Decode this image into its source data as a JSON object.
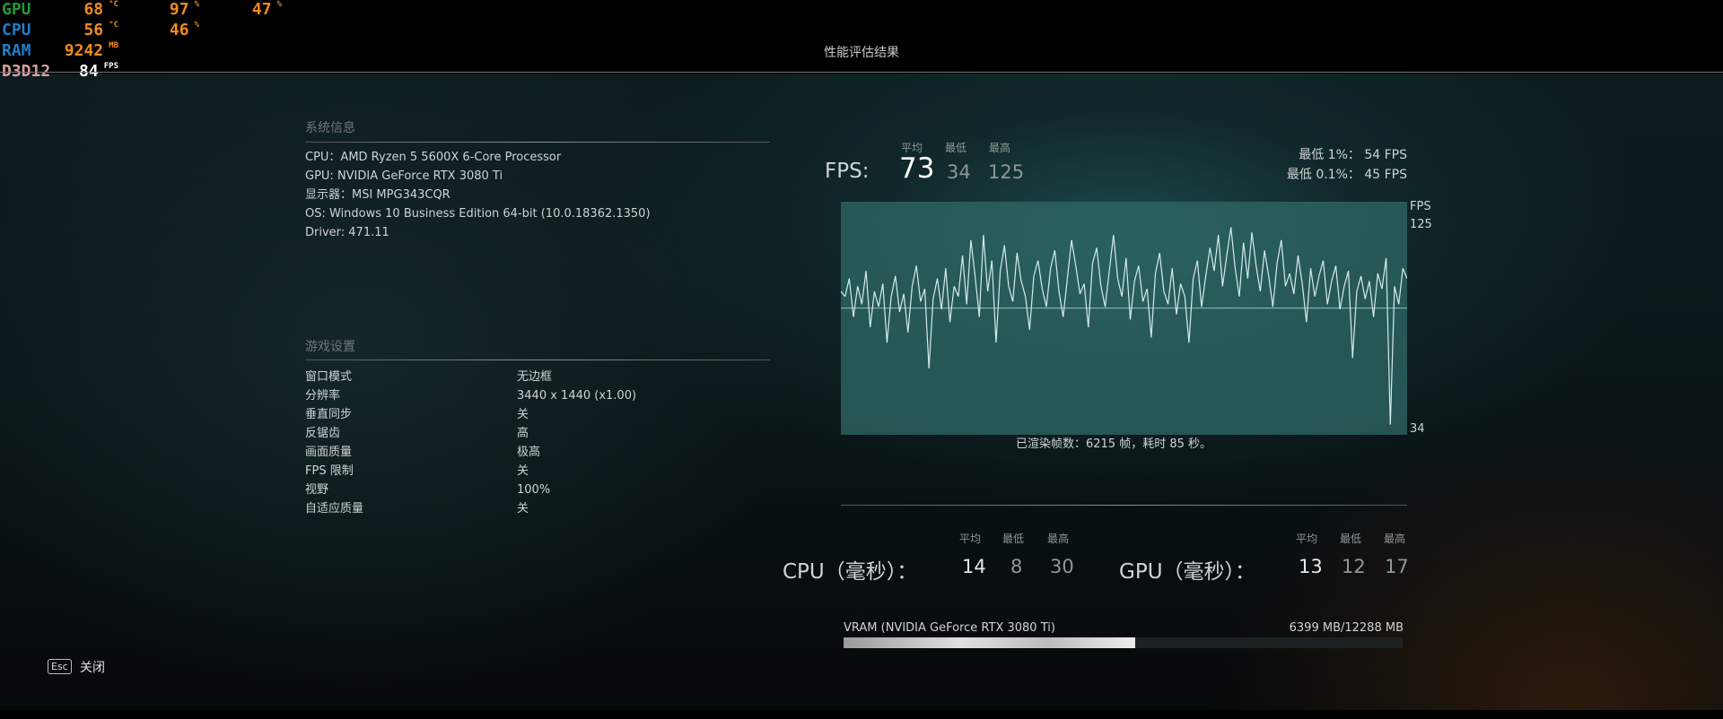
{
  "hud": [
    {
      "label": "GPU",
      "label_color": "#1e9a3a",
      "values": [
        {
          "v": "68",
          "u": "°C"
        },
        {
          "v": "97",
          "u": "%"
        },
        {
          "v": "47",
          "u": "%"
        }
      ]
    },
    {
      "label": "CPU",
      "label_color": "#1e7fc8",
      "values": [
        {
          "v": "56",
          "u": "°C"
        },
        {
          "v": "46",
          "u": "%"
        }
      ]
    },
    {
      "label": "RAM",
      "label_color": "#1e7fc8",
      "values": [
        {
          "v": "9242",
          "u": "MB"
        }
      ]
    },
    {
      "label": "D3D12",
      "label_color": "#d8a0a0",
      "values": [
        {
          "v": "84",
          "u": "FPS"
        }
      ]
    }
  ],
  "title": "性能评估结果",
  "system": {
    "heading": "系统信息",
    "lines": [
      "CPU：AMD Ryzen 5 5600X 6-Core Processor",
      "GPU: NVIDIA GeForce RTX 3080 Ti",
      "显示器：MSI MPG343CQR",
      "OS: Windows 10 Business Edition 64-bit (10.0.18362.1350)",
      "Driver: 471.11"
    ]
  },
  "settings": {
    "heading": "游戏设置",
    "rows": [
      {
        "k": "窗口模式",
        "v": "无边框"
      },
      {
        "k": "分辨率",
        "v": "3440 x 1440 (x1.00)"
      },
      {
        "k": "垂直同步",
        "v": "关"
      },
      {
        "k": "反锯齿",
        "v": "高"
      },
      {
        "k": "画面质量",
        "v": "极高"
      },
      {
        "k": "FPS 限制",
        "v": "关"
      },
      {
        "k": "视野",
        "v": "100%"
      },
      {
        "k": "自适应质量",
        "v": "关"
      }
    ]
  },
  "fps": {
    "label": "FPS:",
    "h_avg": "平均",
    "h_min": "最低",
    "h_max": "最高",
    "avg": "73",
    "min": "34",
    "max": "125",
    "low1": "最低 1%：  54 FPS",
    "low01": "最低 0.1%：  45 FPS",
    "rendered": "已渲染帧数：6215 帧，耗时 85 秒。"
  },
  "chart_data": {
    "type": "line",
    "title": "",
    "ylabel": "FPS",
    "ylim": [
      34,
      125
    ],
    "y_ticks": [
      "125",
      "34"
    ],
    "reference_line": 73,
    "values": [
      90,
      88,
      95,
      80,
      92,
      85,
      98,
      76,
      90,
      84,
      93,
      70,
      88,
      96,
      82,
      89,
      74,
      92,
      100,
      86,
      91,
      60,
      87,
      95,
      83,
      99,
      78,
      92,
      88,
      104,
      85,
      110,
      96,
      80,
      112,
      90,
      102,
      70,
      98,
      108,
      92,
      86,
      105,
      94,
      88,
      75,
      96,
      102,
      91,
      84,
      99,
      106,
      90,
      80,
      95,
      110,
      100,
      89,
      93,
      76,
      101,
      107,
      92,
      84,
      98,
      112,
      95,
      88,
      103,
      79,
      94,
      100,
      86,
      91,
      72,
      97,
      105,
      90,
      85,
      99,
      81,
      93,
      88,
      70,
      95,
      102,
      84,
      96,
      107,
      98,
      112,
      92,
      104,
      115,
      99,
      88,
      109,
      95,
      113,
      100,
      90,
      106,
      96,
      84,
      101,
      110,
      92,
      97,
      89,
      104,
      93,
      78,
      99,
      88,
      96,
      102,
      85,
      94,
      100,
      83,
      92,
      98,
      64,
      90,
      96,
      87,
      94,
      80,
      97,
      91,
      103,
      38,
      92,
      85,
      99,
      95
    ]
  },
  "cpu": {
    "label": "CPU（毫秒）：",
    "h_avg": "平均",
    "h_min": "最低",
    "h_max": "最高",
    "avg": "14",
    "min": "8",
    "max": "30"
  },
  "gpu": {
    "label": "GPU（毫秒）：",
    "h_avg": "平均",
    "h_min": "最低",
    "h_max": "最高",
    "avg": "13",
    "min": "12",
    "max": "17"
  },
  "vram": {
    "label": "VRAM (NVIDIA GeForce RTX 3080 Ti)",
    "value": "6399 MB/12288 MB",
    "fraction": 0.521
  },
  "footer": {
    "key": "Esc",
    "label": "关闭"
  }
}
